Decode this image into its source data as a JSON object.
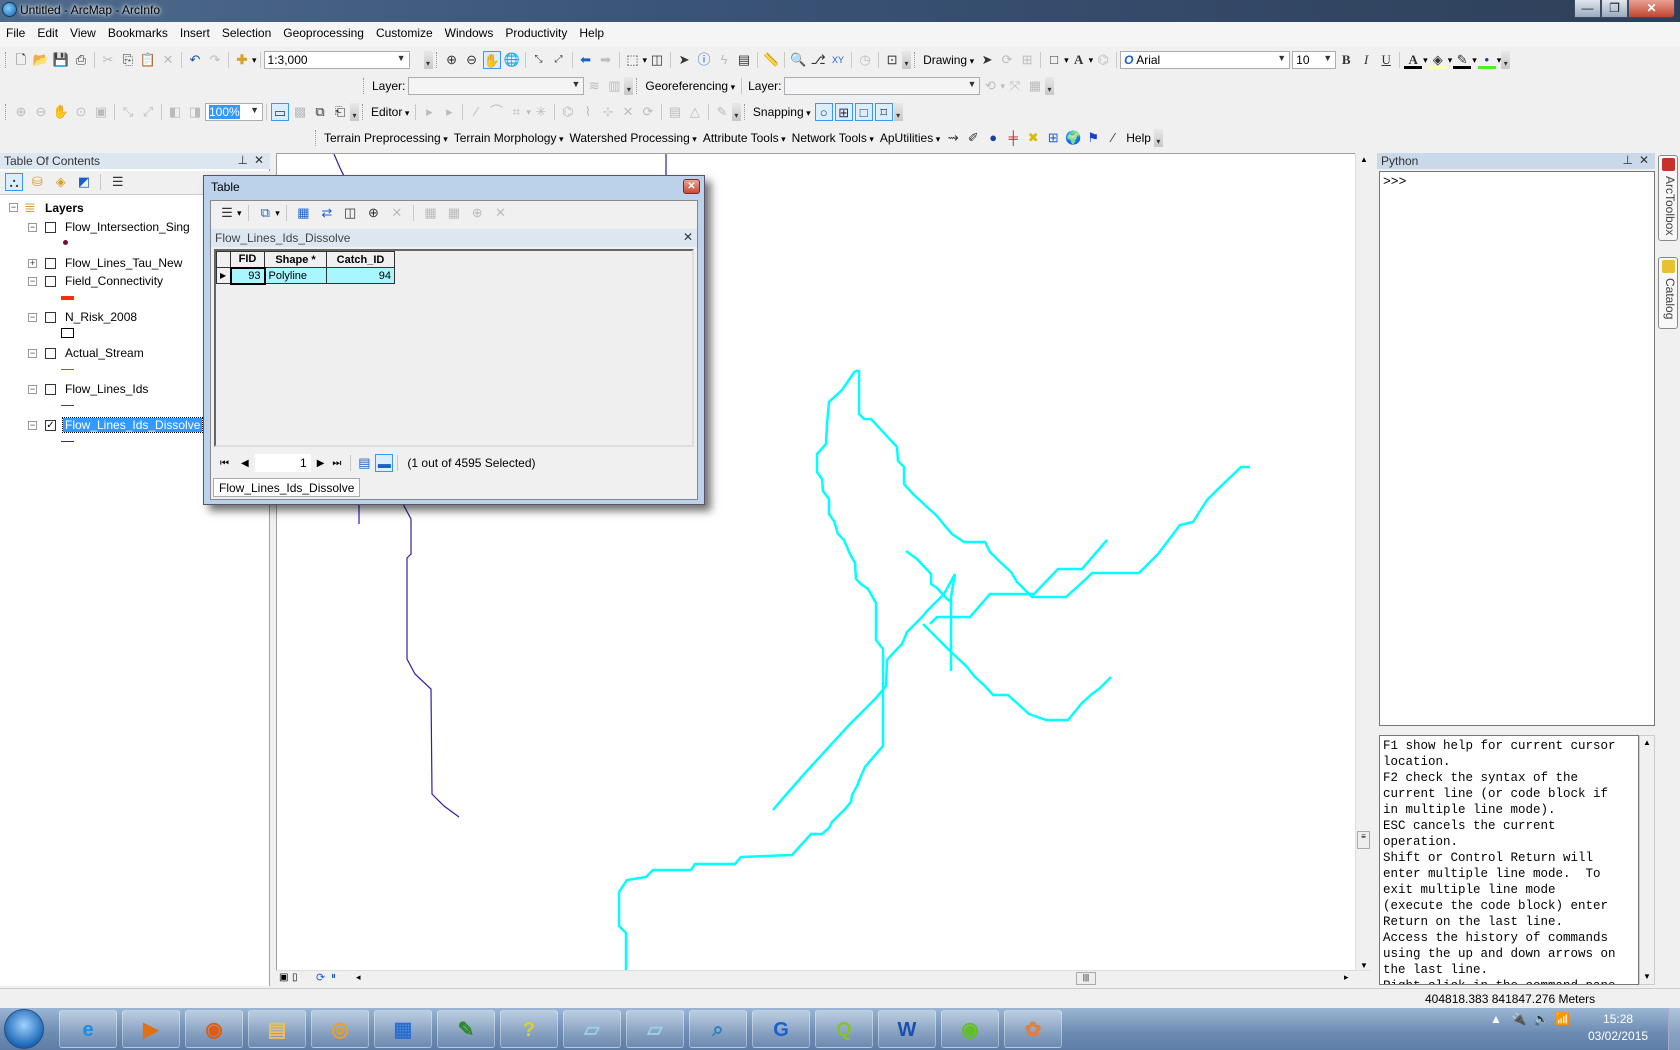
{
  "window": {
    "title": "Untitled - ArcMap - ArcInfo",
    "minimize": "—",
    "maximize": "❐",
    "close": "✕"
  },
  "menu": [
    "File",
    "Edit",
    "View",
    "Bookmarks",
    "Insert",
    "Selection",
    "Geoprocessing",
    "Customize",
    "Windows",
    "Productivity",
    "Help"
  ],
  "toolbar_standard": {
    "scale": "1:3,000"
  },
  "toolbar_drawing": {
    "label": "Drawing",
    "font": "Arial",
    "font_size": "10",
    "bold": "B",
    "italic": "I",
    "underline": "U"
  },
  "toolbar_layer": {
    "layer_label": "Layer:",
    "layer_value": "",
    "georef_label": "Georeferencing",
    "georef_layer_label": "Layer:",
    "georef_layer_value": ""
  },
  "toolbar_layout": {
    "zoom_percent": "100%"
  },
  "toolbar_editor": {
    "editor_label": "Editor",
    "snapping_label": "Snapping"
  },
  "toolbar_custom": {
    "items": [
      "Terrain Preprocessing",
      "Terrain Morphology",
      "Watershed Processing",
      "Attribute Tools",
      "Network Tools",
      "ApUtilities"
    ],
    "help": "Help"
  },
  "toc": {
    "title": "Table Of Contents",
    "root": "Layers",
    "layers": [
      {
        "name": "Flow_Intersection_Sing",
        "checked": false,
        "expanded": true,
        "symbol": "point",
        "color": "#7a1030"
      },
      {
        "name": "Flow_Lines_Tau_New",
        "checked": false,
        "expanded": false,
        "symbol": "none",
        "color": ""
      },
      {
        "name": "Field_Connectivity",
        "checked": false,
        "expanded": true,
        "symbol": "thick-line",
        "color": "#ff2a10"
      },
      {
        "name": "N_Risk_2008",
        "checked": false,
        "expanded": true,
        "symbol": "polygon",
        "color": "#ffffff"
      },
      {
        "name": "Actual_Stream",
        "checked": false,
        "expanded": true,
        "symbol": "line",
        "color": "#6b7a10"
      },
      {
        "name": "Flow_Lines_Ids",
        "checked": false,
        "expanded": true,
        "symbol": "line",
        "color": "#a0107a"
      },
      {
        "name": "Flow_Lines_Ids_Dissolve",
        "checked": true,
        "expanded": true,
        "symbol": "line",
        "color": "#3a20a0",
        "selected": true
      }
    ]
  },
  "table_window": {
    "title": "Table",
    "table_name": "Flow_Lines_Ids_Dissolve",
    "columns": [
      "FID",
      "Shape *",
      "Catch_ID"
    ],
    "rows": [
      [
        "93",
        "Polyline",
        "94"
      ]
    ],
    "current_record": "1",
    "selection_status": "(1 out of 4595 Selected)",
    "tab_label": "Flow_Lines_Ids_Dissolve"
  },
  "map": {
    "selection_color": "#00ffff",
    "line_color": "#3a1aa0"
  },
  "python": {
    "title": "Python",
    "prompt": ">>>",
    "help_text": "F1 show help for current cursor\nlocation.\nF2 check the syntax of the\ncurrent line (or code block if\nin multiple line mode).\nESC cancels the current\noperation.\nShift or Control Return will\nenter multiple line mode.  To\nexit multiple line mode\n(execute the code block) enter\nReturn on the last line.\nAccess the history of commands\nusing the up and down arrows on\nthe last line.\nRight click in the command pane"
  },
  "side_tabs": [
    "ArcToolbox",
    "Catalog"
  ],
  "status": {
    "coordinates": "404818.383  841847.276 Meters"
  },
  "taskbar": {
    "apps": [
      "Internet Explorer",
      "Media Player",
      "Firefox",
      "File Explorer",
      "Outlook",
      "Control Panel",
      "Editor",
      "Help",
      "Notepad",
      "Notepad",
      "ArcGIS Search",
      "Scheduler",
      "QGIS",
      "Word",
      "Spotify",
      "Paint"
    ],
    "time": "15:28",
    "date": "03/02/2015"
  }
}
